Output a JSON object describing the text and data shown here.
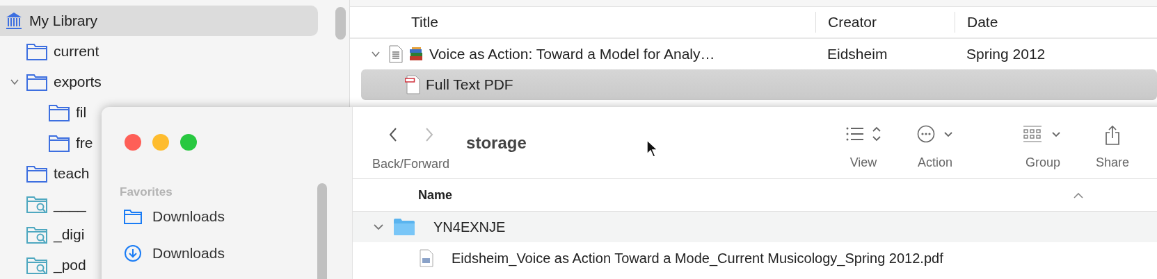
{
  "library_pane": {
    "collections": [
      {
        "label": "My Library",
        "kind": "library",
        "selected": true,
        "children": [
          {
            "label": "current",
            "kind": "folder",
            "selected": false
          },
          {
            "label": "exports",
            "kind": "folder",
            "selected": false,
            "expanded": true,
            "children": [
              {
                "label": "fil",
                "kind": "folder",
                "selected": false
              },
              {
                "label": "fre",
                "kind": "folder",
                "selected": false
              }
            ]
          },
          {
            "label": "teach",
            "kind": "folder",
            "selected": false
          },
          {
            "label": "____",
            "kind": "search",
            "selected": false
          },
          {
            "label": "_digi",
            "kind": "search",
            "selected": false
          },
          {
            "label": "_pod",
            "kind": "search",
            "selected": false
          }
        ]
      }
    ]
  },
  "items_table": {
    "columns": [
      "Title",
      "Creator",
      "Date"
    ],
    "rows": [
      {
        "kind": "item",
        "expanded": true,
        "selected": false,
        "title": "Voice as Action: Toward a Model for Analy…",
        "creator": "Eidsheim",
        "date": "Spring 2012",
        "children": [
          {
            "kind": "attachment",
            "selected": true,
            "title": "Full Text PDF"
          }
        ]
      }
    ]
  },
  "finder_window": {
    "title": "storage",
    "sidebar": {
      "section": "Favorites",
      "items": [
        {
          "label": "Downloads",
          "kind": "folder"
        },
        {
          "label": "Downloads",
          "kind": "download"
        }
      ]
    },
    "navigation": {
      "label": "Back/Forward"
    },
    "toolbar": [
      {
        "label": "View",
        "kind": "view"
      },
      {
        "label": "Action",
        "kind": "action"
      },
      {
        "label": "Group",
        "kind": "group"
      },
      {
        "label": "Share",
        "kind": "share"
      }
    ],
    "columns": [
      "Name"
    ],
    "rows": [
      {
        "name": "YN4EXNJE",
        "kind": "folder",
        "expanded": true,
        "children": [
          {
            "name": "Eidsheim_Voice as Action Toward a Mode_Current Musicology_Spring 2012.pdf",
            "kind": "pdf"
          }
        ]
      }
    ]
  }
}
